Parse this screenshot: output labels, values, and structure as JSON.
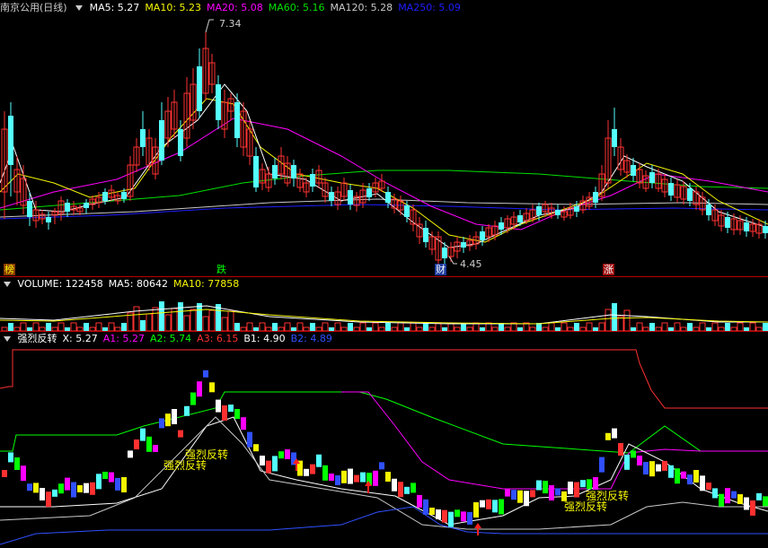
{
  "main": {
    "stock": "南京公用(日线)",
    "ma_labels": [
      {
        "text": "MA5: 5.27",
        "color": "#ffffff"
      },
      {
        "text": "MA10: 5.23",
        "color": "#f6f600"
      },
      {
        "text": "MA20: 5.08",
        "color": "#ff00ff"
      },
      {
        "text": "MA60: 5.16",
        "color": "#00e000"
      },
      {
        "text": "MA120: 5.28",
        "color": "#c8c8c8"
      },
      {
        "text": "MA250: 5.09",
        "color": "#1e1eff"
      }
    ],
    "high_label": "7.34",
    "low_label": "4.45",
    "tags": [
      {
        "text": "榜",
        "color": "#f6f600",
        "bg": "#8a3a00"
      },
      {
        "text": "跌",
        "color": "#00ff00",
        "bg": "#000000"
      },
      {
        "text": "财",
        "color": "#ffffff",
        "bg": "#1a3aa0"
      },
      {
        "text": "涨",
        "color": "#ffffff",
        "bg": "#a01010"
      }
    ]
  },
  "volume": {
    "labels": [
      {
        "text": "VOLUME: 122458",
        "color": "#ffffff"
      },
      {
        "text": "MA5: 80642",
        "color": "#ffffff"
      },
      {
        "text": "MA10: 77858",
        "color": "#f6f600"
      }
    ]
  },
  "indicator": {
    "labels": [
      {
        "text": "强烈反转",
        "color": "#ffffff"
      },
      {
        "text": "X: 5.27",
        "color": "#ffffff"
      },
      {
        "text": "A1: 5.27",
        "color": "#ff00ff"
      },
      {
        "text": "A2: 5.74",
        "color": "#00ff00"
      },
      {
        "text": "A3: 6.15",
        "color": "#ff3030"
      },
      {
        "text": "B1: 4.90",
        "color": "#ffffff"
      },
      {
        "text": "B2: 4.89",
        "color": "#3050ff"
      }
    ],
    "signal_text": "强烈反转"
  },
  "colors": {
    "up": "#ff3232",
    "down": "#54ffff",
    "separator": "#b00000"
  }
}
